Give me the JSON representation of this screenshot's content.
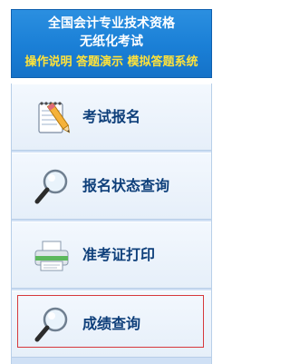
{
  "header": {
    "line1": "全国会计专业技术资格",
    "line2": "无纸化考试",
    "line3": "操作说明 答题演示 模拟答题系统"
  },
  "menu": {
    "items": [
      {
        "label": "考试报名",
        "icon": "notepad-pencil-icon"
      },
      {
        "label": "报名状态查询",
        "icon": "magnifier-icon"
      },
      {
        "label": "准考证打印",
        "icon": "printer-icon"
      },
      {
        "label": "成绩查询",
        "icon": "magnifier-icon",
        "selected": true
      }
    ]
  },
  "colors": {
    "header_bg": "#1a7fd6",
    "header_text": "#ffffff",
    "header_links": "#ffe23a",
    "label_text": "#0e3f7a",
    "selection_border": "#d6393c"
  }
}
